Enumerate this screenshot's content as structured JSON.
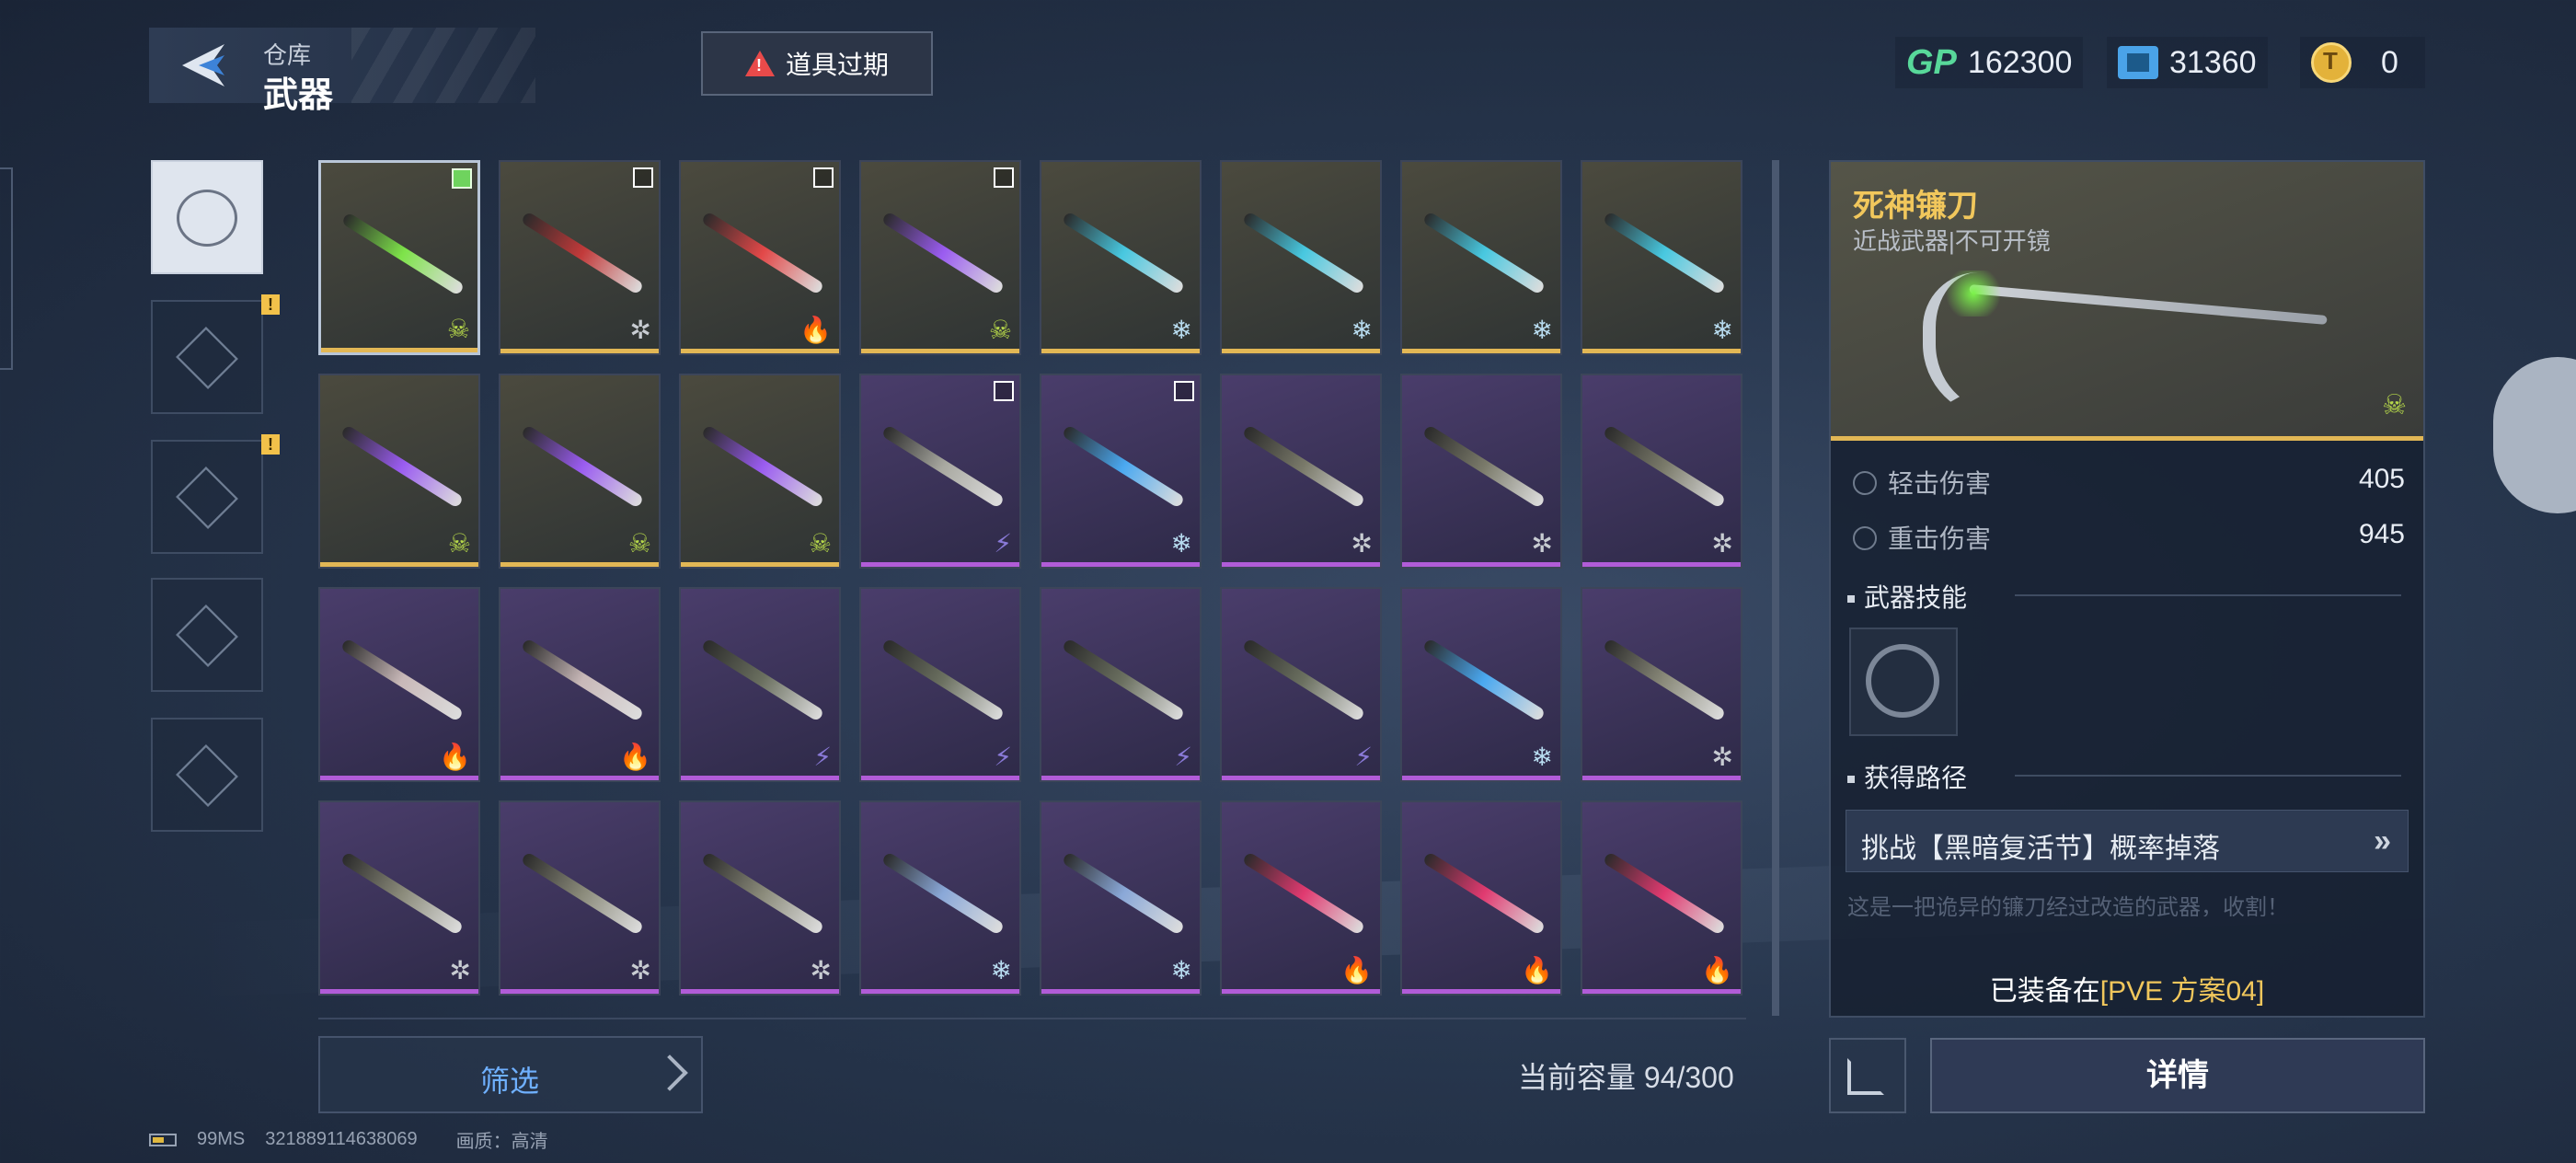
{
  "header": {
    "sub": "仓库",
    "title": "武器"
  },
  "warning": {
    "label": "道具过期",
    "icon": "warning-triangle-icon"
  },
  "currencies": [
    {
      "icon": "gp-icon",
      "label": "GP",
      "value": "162300"
    },
    {
      "icon": "ticket-icon",
      "value": "31360"
    },
    {
      "icon": "coin-icon",
      "value": "0"
    }
  ],
  "categories": [
    {
      "name": "weapons",
      "icon": "gun-icon",
      "active": true,
      "badge": ""
    },
    {
      "name": "frames",
      "icon": "frame-icon",
      "active": false,
      "badge": "!"
    },
    {
      "name": "capsules",
      "icon": "capsule-icon",
      "active": false,
      "badge": "!"
    },
    {
      "name": "vehicles",
      "icon": "vehicle-icon",
      "active": false,
      "badge": ""
    },
    {
      "name": "tools",
      "icon": "compass-icon",
      "active": false,
      "badge": ""
    }
  ],
  "grid": [
    [
      {
        "r": "gold",
        "e": "skull",
        "c": "#7ee34a",
        "chk": "on",
        "sel": true
      },
      {
        "r": "gold",
        "e": "star",
        "c": "#c23a3a",
        "chk": "off"
      },
      {
        "r": "gold",
        "e": "fire",
        "c": "#e24848",
        "chk": "off"
      },
      {
        "r": "gold",
        "e": "skull",
        "c": "#9a5cf0",
        "chk": "off"
      },
      {
        "r": "gold",
        "e": "ice",
        "c": "#48c8e0"
      },
      {
        "r": "gold",
        "e": "ice",
        "c": "#48c8e0"
      },
      {
        "r": "gold",
        "e": "ice",
        "c": "#48c8e0"
      },
      {
        "r": "gold",
        "e": "ice",
        "c": "#48c8e0"
      }
    ],
    [
      {
        "r": "gold",
        "e": "skull",
        "c": "#9a5cf0"
      },
      {
        "r": "gold",
        "e": "skull",
        "c": "#9a5cf0"
      },
      {
        "r": "gold",
        "e": "skull",
        "c": "#9a5cf0"
      },
      {
        "r": "purple",
        "e": "bolt",
        "c": "#a8a8a0",
        "chk": "off"
      },
      {
        "r": "purple",
        "e": "ice",
        "c": "#4aa8f0",
        "chk": "off"
      },
      {
        "r": "purple",
        "e": "star",
        "c": "#7a7a6a"
      },
      {
        "r": "purple",
        "e": "star",
        "c": "#7a7a6a"
      },
      {
        "r": "purple",
        "e": "star",
        "c": "#7a7a6a"
      }
    ],
    [
      {
        "r": "purple",
        "e": "fire",
        "c": "#c8b8b8"
      },
      {
        "r": "purple",
        "e": "fire",
        "c": "#c8b8b8"
      },
      {
        "r": "purple",
        "e": "bolt",
        "c": "#6b7060"
      },
      {
        "r": "purple",
        "e": "bolt",
        "c": "#6b7060"
      },
      {
        "r": "purple",
        "e": "bolt",
        "c": "#6b7060"
      },
      {
        "r": "purple",
        "e": "bolt",
        "c": "#6b7060"
      },
      {
        "r": "purple",
        "e": "ice",
        "c": "#4aa8f0"
      },
      {
        "r": "purple",
        "e": "star",
        "c": "#8a8a7a"
      }
    ],
    [
      {
        "r": "purple",
        "e": "star",
        "c": "#8a8a7a"
      },
      {
        "r": "purple",
        "e": "star",
        "c": "#8a8a7a"
      },
      {
        "r": "purple",
        "e": "star",
        "c": "#8a8a7a"
      },
      {
        "r": "purple",
        "e": "ice",
        "c": "#8aa8d8"
      },
      {
        "r": "purple",
        "e": "ice",
        "c": "#8aa8d8"
      },
      {
        "r": "purple",
        "e": "fire",
        "c": "#e03a70"
      },
      {
        "r": "purple",
        "e": "fire",
        "c": "#e03a70"
      },
      {
        "r": "purple",
        "e": "fire",
        "c": "#e03a70"
      }
    ]
  ],
  "element_glyphs": {
    "skull": "☠",
    "star": "✲",
    "fire": "🔥",
    "ice": "❄",
    "bolt": "⚡"
  },
  "element_colors": {
    "skull": "#b6d84a",
    "star": "#c8ccd2",
    "fire": "#f0a030",
    "ice": "#b8dcf0",
    "bolt": "#8a7ad8"
  },
  "filter": {
    "label": "筛选"
  },
  "capacity": "当前容量 94/300",
  "footer": {
    "ping": "99MS",
    "uid": "321889114638069",
    "quality": "画质：高清"
  },
  "detail": {
    "name": "死神镰刀",
    "type": "近战武器|不可开镜",
    "stats": [
      {
        "label": "轻击伤害",
        "value": "405"
      },
      {
        "label": "重击伤害",
        "value": "945"
      }
    ],
    "skill_title": "武器技能",
    "route_title": "获得路径",
    "route": "挑战【黑暗复活节】概率掉落",
    "route_arrow": "»",
    "faded_text": "这是一把诡异的镰刀经过改造的武器，收割！",
    "equipped_prefix": "已装备在",
    "equipped_plan": "[PVE 方案04]",
    "detail_btn": "详情"
  },
  "colors": {
    "gold": "#e2b755",
    "purple": "#b15cd8",
    "accent": "#6fb0ff"
  }
}
